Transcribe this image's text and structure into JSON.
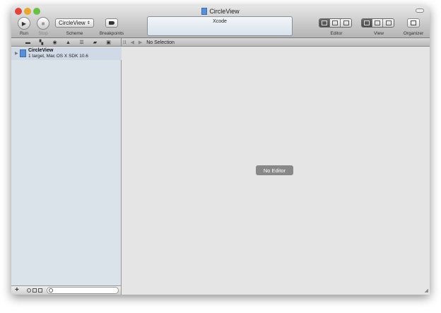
{
  "window": {
    "title": "CircleView"
  },
  "toolbar": {
    "run_label": "Run",
    "stop_label": "Stop",
    "scheme_value": "CircleView",
    "scheme_label": "Scheme",
    "breakpoints_label": "Breakpoints",
    "activity_text": "Xcode",
    "editor_label": "Editor",
    "view_label": "View",
    "organizer_label": "Organizer"
  },
  "navigator": {
    "tabs": [
      "project-navigator",
      "symbol-navigator",
      "search-navigator",
      "issue-navigator",
      "debug-navigator",
      "breakpoint-navigator",
      "log-navigator"
    ],
    "project": {
      "name": "CircleView",
      "subtitle": "1 target, Mac OS X SDK 10.6"
    }
  },
  "jumpbar": {
    "selection": "No Selection"
  },
  "editor": {
    "placeholder": "No Editor"
  }
}
